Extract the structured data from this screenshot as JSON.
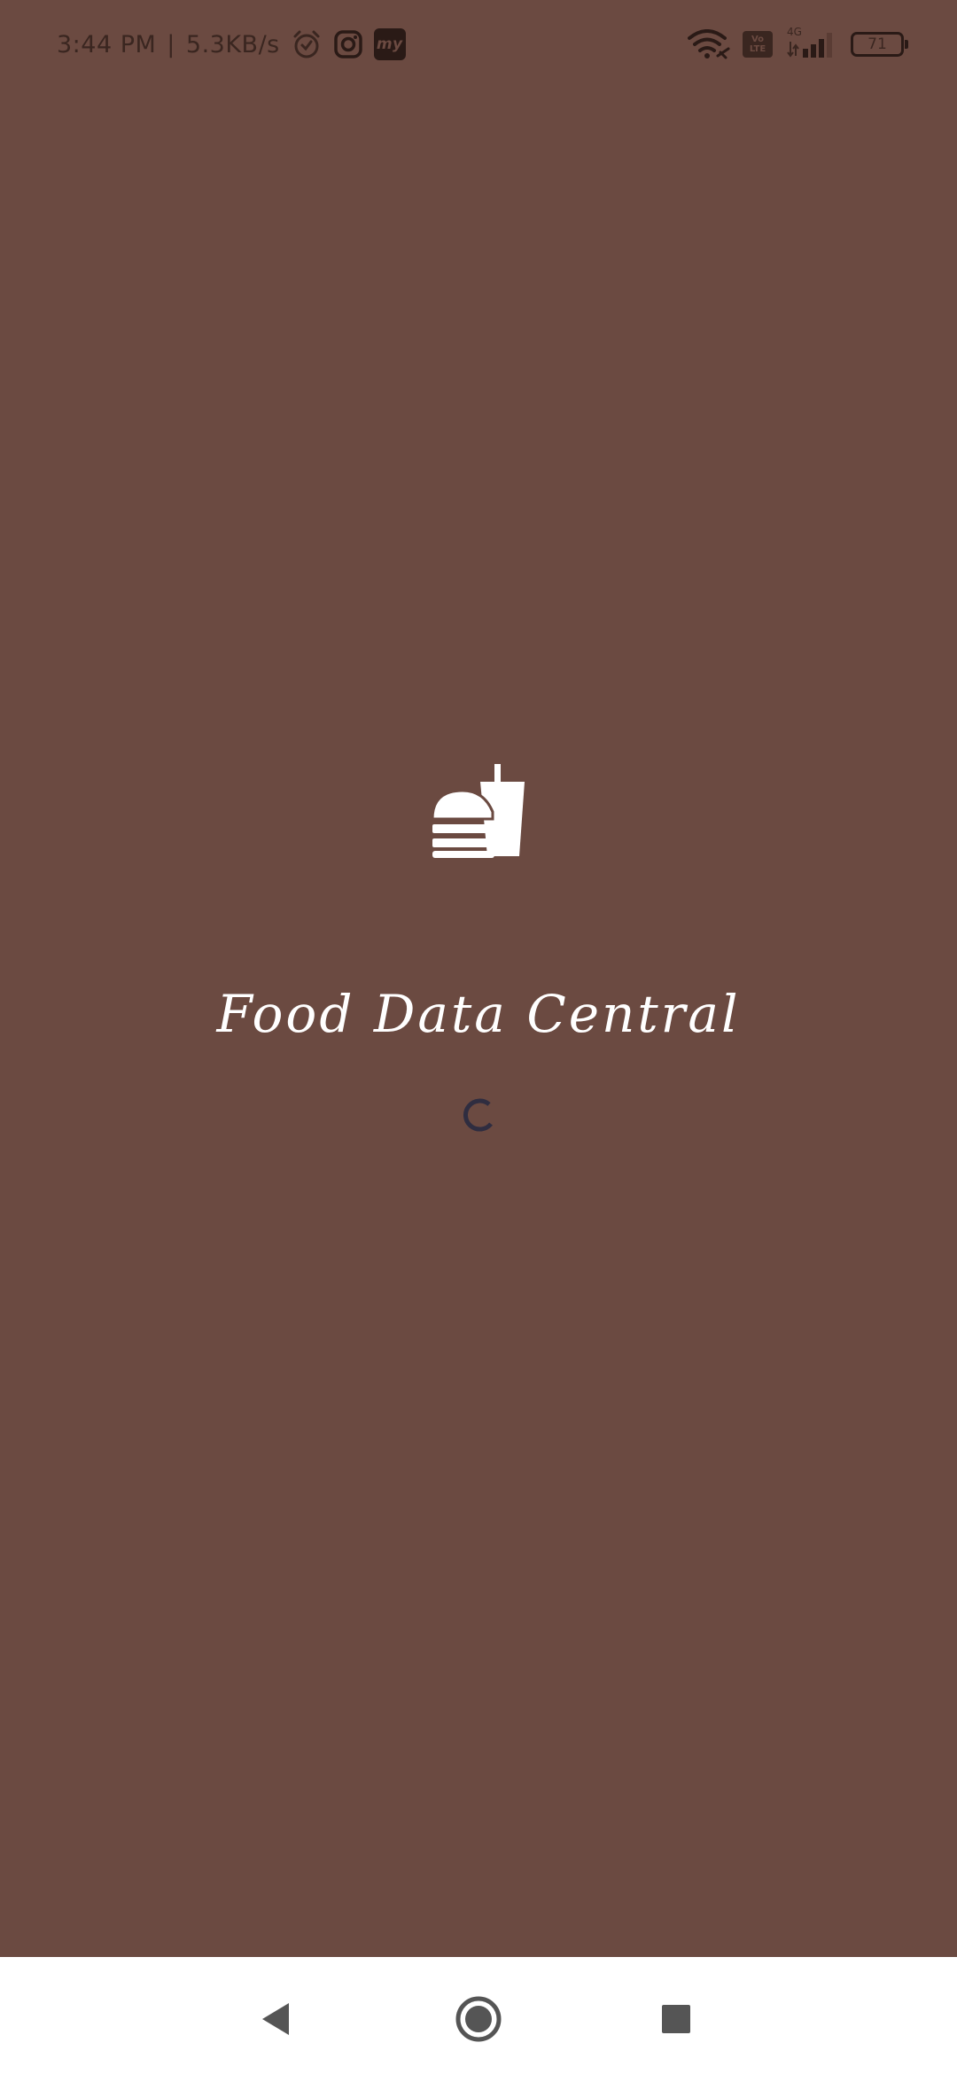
{
  "status_bar": {
    "time": "3:44 PM",
    "separator": "|",
    "network_speed": "5.3KB/s",
    "left_icons": [
      "alarm-icon",
      "instagram-icon",
      "mytoi-icon"
    ],
    "mt_badge": "my",
    "volte_line1": "Vo",
    "volte_line2": "LTE",
    "network_type": "4G",
    "battery_level": "71"
  },
  "splash": {
    "logo_icon": "fastfood-icon",
    "title": "Food Data Central",
    "loading": true
  },
  "nav_bar": {
    "back": "back-icon",
    "home": "home-icon",
    "recents": "recents-icon"
  },
  "colors": {
    "background": "#6b4a41",
    "title": "#ffffff",
    "spinner": "#2f2d40",
    "nav_bar": "#ffffff"
  }
}
